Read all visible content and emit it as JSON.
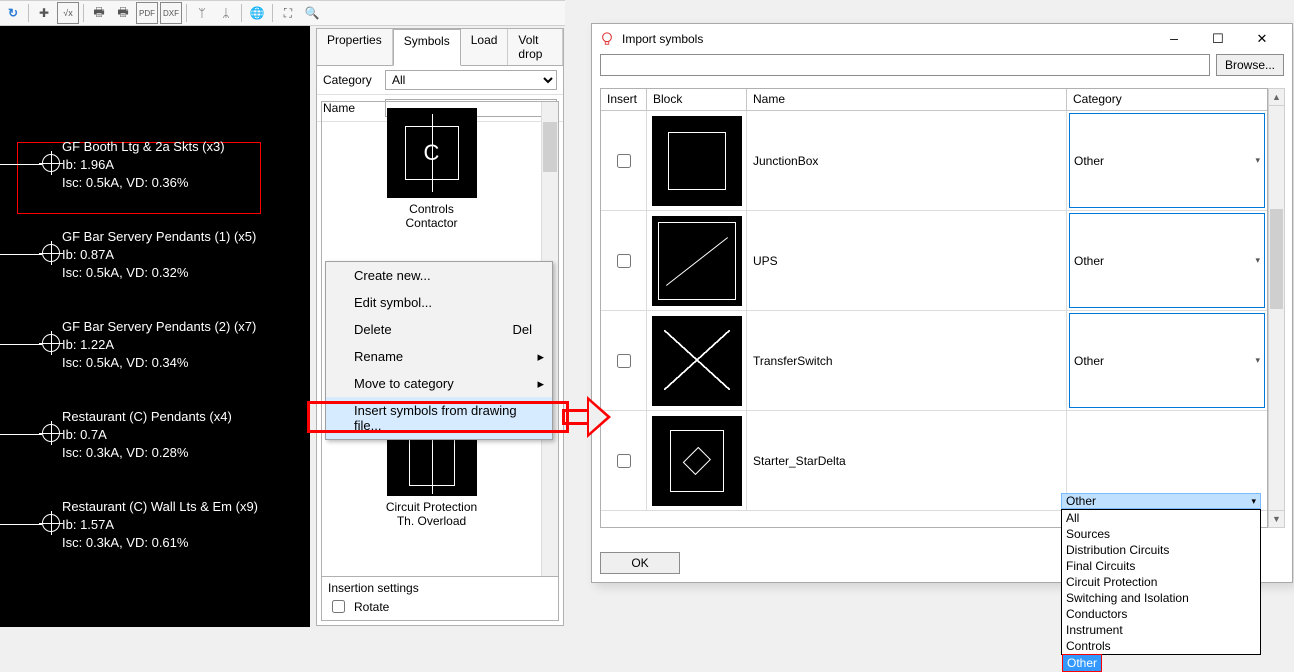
{
  "tabs": {
    "prop": "Properties",
    "sym": "Symbols",
    "load": "Load",
    "volt": "Volt drop"
  },
  "filters": {
    "category_label": "Category",
    "category_value": "All",
    "name_label": "Name",
    "name_value": ""
  },
  "symbol_tiles": [
    {
      "cap1": "Controls",
      "cap2": "Contactor"
    },
    {
      "cap1": "Circuit Protection",
      "cap2": "Th. Overload"
    }
  ],
  "insertion_settings": {
    "title": "Insertion settings",
    "rotate": "Rotate"
  },
  "context_menu": [
    {
      "label": "Create new..."
    },
    {
      "label": "Edit symbol..."
    },
    {
      "label": "Delete",
      "shortcut": "Del"
    },
    {
      "label": "Rename",
      "submenu": true
    },
    {
      "label": "Move to category",
      "submenu": true
    },
    {
      "label": "Insert symbols from drawing file...",
      "highlight": true
    }
  ],
  "circuits": [
    {
      "l1": "GF Booth Ltg & 2a Skts (x3)",
      "l2": "Ib: 1.96A",
      "l3": "Isc: 0.5kA, VD: 0.36%",
      "selected": true
    },
    {
      "l1": "GF Bar Servery Pendants (1) (x5)",
      "l2": "Ib: 0.87A",
      "l3": "Isc: 0.5kA, VD: 0.32%"
    },
    {
      "l1": "GF Bar Servery Pendants (2) (x7)",
      "l2": "Ib: 1.22A",
      "l3": "Isc: 0.5kA, VD: 0.34%"
    },
    {
      "l1": "Restaurant (C) Pendants  (x4)",
      "l2": "Ib: 0.7A",
      "l3": "Isc: 0.3kA, VD: 0.28%"
    },
    {
      "l1": "Restaurant (C) Wall Lts & Em (x9)",
      "l2": "Ib: 1.57A",
      "l3": "Isc: 0.3kA, VD: 0.61%"
    }
  ],
  "dialog": {
    "title": "Import symbols",
    "browse": "Browse...",
    "path": "",
    "ok": "OK",
    "headers": {
      "insert": "Insert",
      "block": "Block",
      "name": "Name",
      "category": "Category"
    },
    "rows": [
      {
        "name": "JunctionBox",
        "category": "Other",
        "thumb": "shape-rect"
      },
      {
        "name": "UPS",
        "category": "Other",
        "thumb": "shape-line1"
      },
      {
        "name": "TransferSwitch",
        "category": "Other",
        "thumb": "shape-tri"
      },
      {
        "name": "Starter_StarDelta",
        "category": "Other",
        "thumb": "shape-star"
      }
    ],
    "dropdown": {
      "selected": "Other",
      "options": [
        "All",
        "Sources",
        "Distribution Circuits",
        "Final Circuits",
        "Circuit Protection",
        "Switching and Isolation",
        "Conductors",
        "Instrument",
        "Controls",
        "Other"
      ]
    }
  }
}
